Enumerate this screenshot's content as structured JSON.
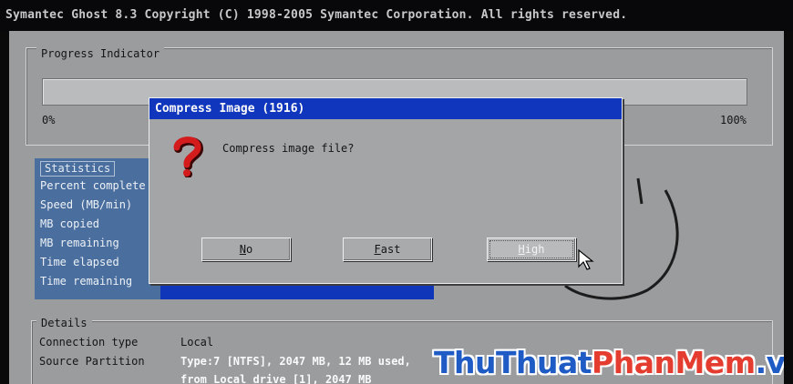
{
  "app": {
    "title_bar": "Symantec Ghost 8.3   Copyright (C) 1998-2005 Symantec Corporation. All rights reserved."
  },
  "progress": {
    "group_label": "Progress Indicator",
    "start_label": "0%",
    "end_label": "100%",
    "fraction": 0
  },
  "statistics": {
    "group_label": "Statistics",
    "rows": [
      "Percent complete",
      "Speed (MB/min)",
      "MB copied",
      "MB remaining",
      "Time elapsed",
      "Time remaining"
    ]
  },
  "details": {
    "group_label": "Details",
    "connection_type_label": "Connection type",
    "connection_type_value": "Local",
    "source_partition_label": "Source Partition",
    "source_partition_line1": "Type:7 [NTFS], 2047 MB, 12 MB used,",
    "source_partition_line2": "from Local drive [1], 2047 MB"
  },
  "dialog": {
    "title": "Compress Image (1916)",
    "message": "Compress image file?",
    "icon": "question-mark-icon",
    "buttons": {
      "no": {
        "accel": "N",
        "rest": "o"
      },
      "fast": {
        "accel": "F",
        "rest": "ast"
      },
      "high": {
        "accel": "H",
        "rest": "igh"
      }
    },
    "selected_button": "high"
  },
  "watermark": {
    "part1": "ThuThuat",
    "part2": "PhanMem",
    "part3": ".vn"
  },
  "colors": {
    "dialog_title_bg": "#0f36bd",
    "stats_bg": "#4a6f9f",
    "stats_value_bg": "#0f35b9",
    "background": "#9a9c9e"
  }
}
